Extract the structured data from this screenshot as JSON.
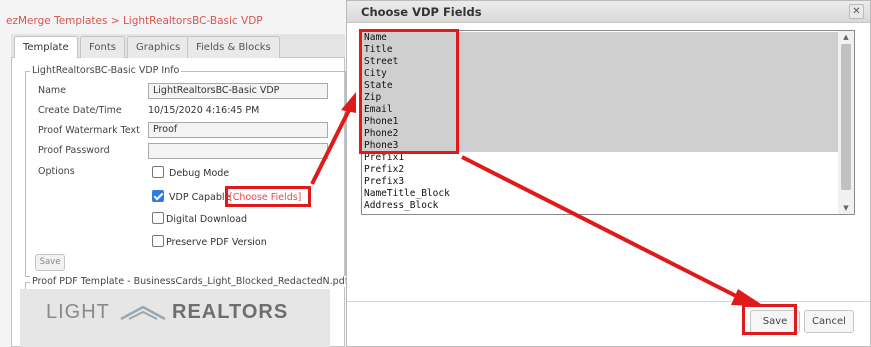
{
  "breadcrumb": {
    "root": "ezMerge Templates",
    "separator": " > ",
    "current": "LightRealtorsBC-Basic VDP"
  },
  "tabs": [
    {
      "label": "Template",
      "active": true
    },
    {
      "label": "Fonts",
      "active": false
    },
    {
      "label": "Graphics",
      "active": false
    },
    {
      "label": "Fields & Blocks",
      "active": false
    }
  ],
  "info": {
    "legend": "LightRealtorsBC-Basic VDP Info",
    "name_label": "Name",
    "name_value": "LightRealtorsBC-Basic VDP",
    "date_label": "Create Date/Time",
    "date_value": "10/15/2020 4:16:45 PM",
    "watermark_label": "Proof Watermark Text",
    "watermark_value": "Proof",
    "password_label": "Proof Password",
    "password_value": "",
    "options_label": "Options",
    "debug_label": "Debug Mode",
    "debug_checked": false,
    "vdp_label": "VDP Capable",
    "vdp_checked": true,
    "choose_fields_link": "[Choose Fields]",
    "digital_label": "Digital Download",
    "digital_checked": false,
    "preserve_label": "Preserve PDF Version",
    "preserve_checked": false,
    "save_label": "Save"
  },
  "proof": {
    "legend": "Proof PDF Template - BusinessCards_Light_Blocked_RedactedN.pdf",
    "logo_left": "LIGHT",
    "logo_right": "REALTORS"
  },
  "dialog": {
    "title": "Choose VDP Fields",
    "close_icon": "close-icon",
    "fields": [
      {
        "label": "Name",
        "selected": true
      },
      {
        "label": "Title",
        "selected": true
      },
      {
        "label": "Street",
        "selected": true
      },
      {
        "label": "City",
        "selected": true
      },
      {
        "label": "State",
        "selected": true
      },
      {
        "label": "Zip",
        "selected": true
      },
      {
        "label": "Email",
        "selected": true
      },
      {
        "label": "Phone1",
        "selected": true
      },
      {
        "label": "Phone2",
        "selected": true
      },
      {
        "label": "Phone3",
        "selected": true
      },
      {
        "label": "Prefix1",
        "selected": false
      },
      {
        "label": "Prefix2",
        "selected": false
      },
      {
        "label": "Prefix3",
        "selected": false
      },
      {
        "label": "NameTitle_Block",
        "selected": false
      },
      {
        "label": "Address_Block",
        "selected": false
      }
    ],
    "save_label": "Save",
    "cancel_label": "Cancel"
  },
  "colors": {
    "highlight": "#e01a1a",
    "link": "#e8484b",
    "checkbox_checked": "#2c7be5",
    "selected_option": "#cfcfcf"
  }
}
